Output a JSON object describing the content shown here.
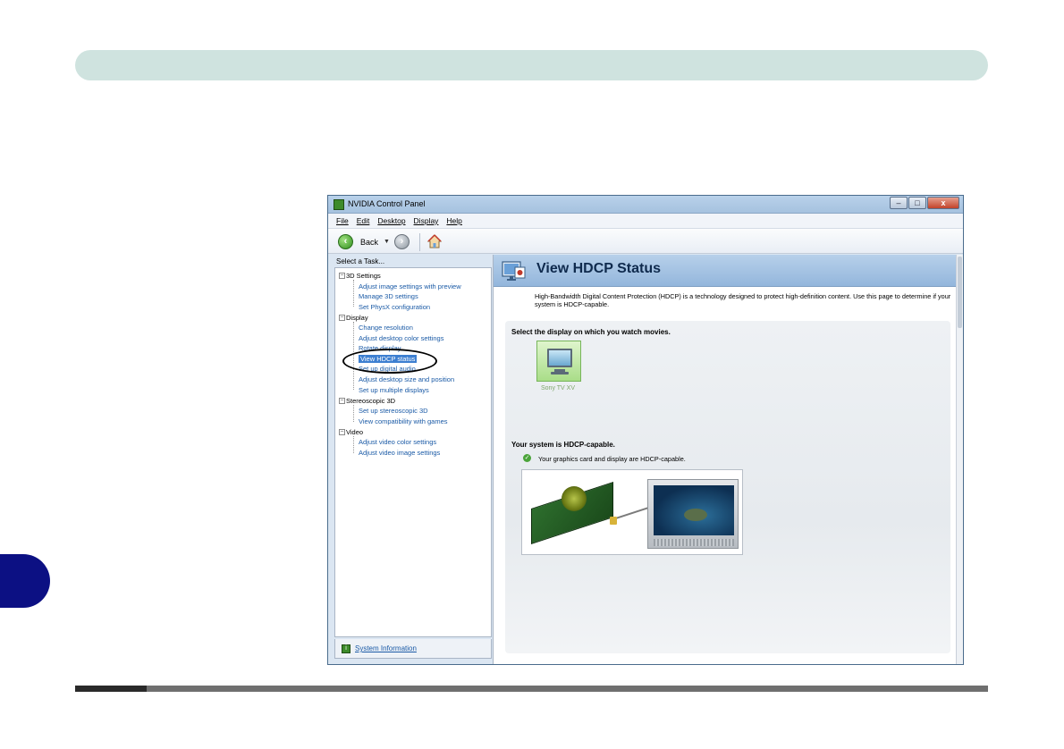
{
  "window": {
    "title": "NVIDIA Control Panel",
    "controls": {
      "minimize": "–",
      "maximize": "□",
      "close": "x"
    }
  },
  "menu": [
    "File",
    "Edit",
    "Desktop",
    "Display",
    "Help"
  ],
  "toolbar": {
    "back_label": "Back",
    "dropdown_glyph": "▼",
    "icons": [
      "back-icon",
      "forward-icon",
      "home-icon"
    ]
  },
  "sidebar": {
    "header": "Select a Task...",
    "categories": [
      {
        "label": "3D Settings",
        "items": [
          "Adjust image settings with preview",
          "Manage 3D settings",
          "Set PhysX configuration"
        ]
      },
      {
        "label": "Display",
        "items": [
          "Change resolution",
          "Adjust desktop color settings",
          "Rotate display",
          "View HDCP status",
          "Set up digital audio",
          "Adjust desktop size and position",
          "Set up multiple displays"
        ]
      },
      {
        "label": "Stereoscopic 3D",
        "items": [
          "Set up stereoscopic 3D",
          "View compatibility with games"
        ]
      },
      {
        "label": "Video",
        "items": [
          "Adjust video color settings",
          "Adjust video image settings"
        ]
      }
    ],
    "selected_item": "View HDCP status",
    "system_information": "System Information"
  },
  "main": {
    "title": "View HDCP Status",
    "description": "High-Bandwidth Digital Content Protection (HDCP) is a technology designed to protect high-definition content. Use this page to determine if your system is HDCP-capable.",
    "select_display_label": "Select the display on which you watch movies.",
    "display_name": "Sony TV XV",
    "status_heading": "Your system is HDCP-capable.",
    "status_detail": "Your graphics card and display are HDCP-capable."
  },
  "colors": {
    "header_bar": "#cfe3df",
    "side_tab": "#0c1083",
    "link_blue": "#1a5aa6",
    "selection": "#3d7fd1",
    "status_green": "#4ba43a"
  }
}
